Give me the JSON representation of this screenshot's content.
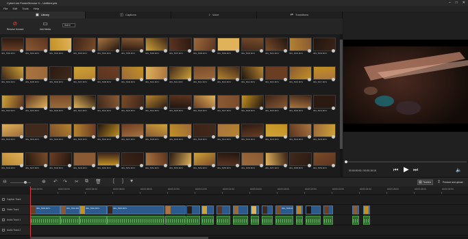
{
  "window": {
    "title": "CyberLink PowerDirector 9 – Untitled.pds"
  },
  "menu": [
    "File",
    "Edit",
    "Tools",
    "Help"
  ],
  "tabs": [
    {
      "label": "Library",
      "icon": "folder-icon",
      "active": true
    },
    {
      "label": "Captions",
      "icon": "caption-icon",
      "active": false
    },
    {
      "label": "Voice",
      "icon": "mic-icon",
      "active": false
    },
    {
      "label": "Transitions",
      "icon": "transition-icon",
      "active": false
    }
  ],
  "library": {
    "remove_label": "Remove Unused",
    "add_label": "Add Media",
    "sort_label": "Sort"
  },
  "grid": {
    "rows": [
      [
        "IMG_5590.MOV",
        "IMG_5591.MOV",
        "IMG_5592.MOV",
        "IMG_5593.MOV",
        "IMG_5594.MOV",
        "IMG_5595.MOV",
        "IMG_5596.MOV",
        "IMG_5597.MOV",
        "IMG_5598.MOV",
        "IMG_5599.MOV",
        "IMG_5600.MOV",
        "IMG_5601.MOV",
        "IMG_5602.MOV",
        "IMG_5603.MOV"
      ],
      [
        "IMG_5604.MOV",
        "IMG_5605.MOV",
        "IMG_5606.MOV",
        "IMG_5607.MOV",
        "IMG_5608.MOV",
        "IMG_5609.MOV",
        "IMG_5610.MOV",
        "IMG_5611.MOV",
        "IMG_5612.MOV",
        "IMG_5613.MOV",
        "IMG_5614.MOV",
        "IMG_5615.MOV",
        "IMG_5616.MOV",
        "IMG_5617.MOV"
      ],
      [
        "IMG_5618.MOV",
        "IMG_5619.MOV",
        "IMG_5620.MOV",
        "IMG_5621.MOV",
        "IMG_5622.MOV",
        "IMG_5623.MOV",
        "IMG_5624.MOV",
        "IMG_5625.MOV",
        "IMG_5626.MOV",
        "IMG_5627.MOV",
        "IMG_5628.MOV",
        "IMG_5629.MOV",
        "IMG_5630.MOV",
        "IMG_5631.MOV"
      ],
      [
        "IMG_5632.MOV",
        "IMG_5633.MOV",
        "IMG_5634.MOV",
        "IMG_5635.MOV",
        "IMG_5636.MOV",
        "IMG_5637.MOV",
        "IMG_5638.MOV",
        "IMG_5639.MOV",
        "IMG_5640.MOV",
        "IMG_5641.MOV",
        "IMG_5642.MOV",
        "IMG_5643.MOV",
        "IMG_5644.MOV",
        "IMG_5645.MOV"
      ],
      [
        "IMG_5646.MOV",
        "IMG_5647.MOV",
        "IMG_5648.MOV",
        "IMG_5649.MOV",
        "IMG_5650.MOV",
        "IMG_5651.MOV",
        "IMG_5652.MOV",
        "IMG_5653.MOV",
        "IMG_5654.MOV",
        "IMG_5655.MOV",
        "IMG_5656.MOV",
        "IMG_5657.MOV",
        "IMG_5658.MOV",
        "IMG_5659.MOV"
      ]
    ],
    "tones": [
      "#6b3d23",
      "#8a5a34",
      "#c39022",
      "#3d2418",
      "#a9743f",
      "#2a1a12",
      "#cfa237",
      "#5c3420",
      "#9b6a3b",
      "#e0b25a",
      "#41291b",
      "#7a4c2a",
      "#b5832f",
      "#20150f"
    ]
  },
  "preview": {
    "timecode": "00:00:00:00",
    "duration": "00:00:15:15"
  },
  "timeline_toolbar": {
    "mode_label": "Timeline",
    "produce_label": "Produce and upload"
  },
  "ruler": [
    "00:00:00:00",
    "00:00:02:00",
    "00:00:04:00",
    "00:00:06:00",
    "00:00:08:00",
    "00:00:10:00",
    "00:00:12:00",
    "00:00:14:00",
    "00:00:16:00",
    "00:00:18:00",
    "00:00:20:00",
    "00:00:22:00",
    "00:00:24:00",
    "00:00:26:00",
    "00:00:28:00",
    "00:00:30:00"
  ],
  "tracks": [
    {
      "label": "Caption Track"
    },
    {
      "label": "Video Track"
    },
    {
      "label": "Audio Track 1"
    },
    {
      "label": "Audio Track 2"
    }
  ],
  "video_clips": [
    "IMG_5590.MOV",
    "IMG_5591.MOV",
    "IMG_5592.MOV",
    "IMG_5593.MOV",
    "",
    "",
    "",
    "",
    "",
    "",
    "",
    "IMG_5609.MOV",
    "",
    "",
    "",
    "",
    ""
  ]
}
